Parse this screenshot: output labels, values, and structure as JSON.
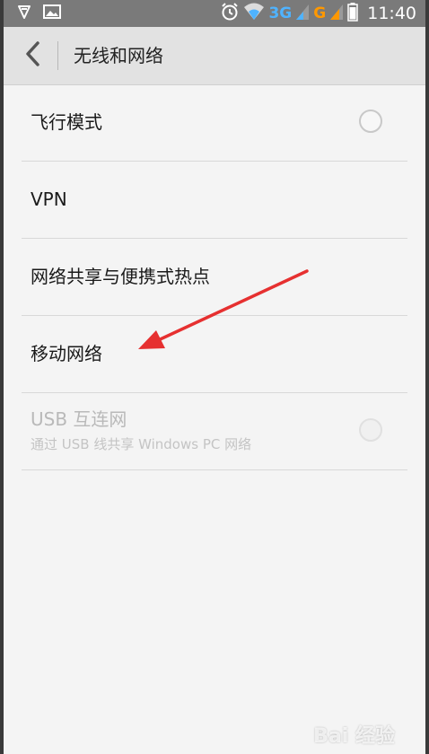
{
  "status_bar": {
    "network_3g": "3G",
    "network_g": "G",
    "time": "11:40"
  },
  "header": {
    "title": "无线和网络"
  },
  "settings": {
    "items": [
      {
        "title": "飞行模式",
        "toggle": false
      },
      {
        "title": "VPN"
      },
      {
        "title": "网络共享与便携式热点"
      },
      {
        "title": "移动网络"
      },
      {
        "title": "USB 互连网",
        "subtitle": "通过 USB 线共享 Windows PC 网络",
        "toggle": false,
        "disabled": true
      }
    ]
  },
  "annotation": {
    "arrow_color": "#e63030"
  },
  "watermark": {
    "text": "Bai 经验"
  },
  "colors": {
    "status_bar": "#7a7a7a",
    "app_bar": "#e2e2e2",
    "background": "#f4f4f4"
  },
  "icons": [
    "shield-icon",
    "image-icon",
    "alarm-icon",
    "wifi-icon",
    "signal-icon",
    "battery-icon",
    "back-chevron-icon"
  ]
}
